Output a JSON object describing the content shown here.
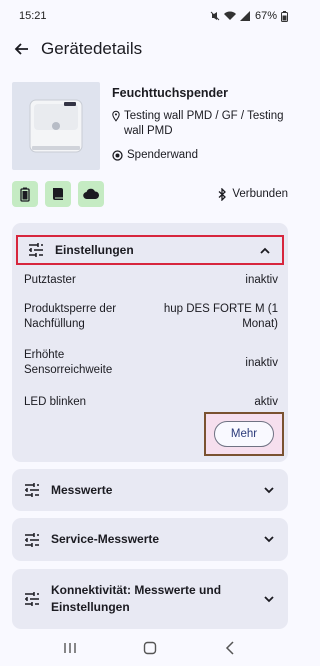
{
  "status_bar": {
    "time": "15:21",
    "battery": "67%"
  },
  "header": {
    "title": "Gerätedetails"
  },
  "product": {
    "name": "Feuchttuchspender",
    "location": "Testing wall PMD / GF / Testing wall  PMD",
    "wall": "Spenderwand"
  },
  "connection": {
    "status": "Verbunden"
  },
  "settings": {
    "title": "Einstellungen",
    "rows": [
      {
        "label": "Putztaster",
        "value": "inaktiv"
      },
      {
        "label": "Produktsperre der Nachfüllung",
        "value": "hup DES FORTE M (1 Monat)"
      },
      {
        "label": "Erhöhte Sensorreichweite",
        "value": "inaktiv"
      },
      {
        "label": "LED blinken",
        "value": "aktiv"
      }
    ],
    "more_label": "Mehr"
  },
  "sections": [
    {
      "title": "Messwerte"
    },
    {
      "title": "Service-Messwerte"
    },
    {
      "title": "Konnektivität: Messwerte und Einstellungen"
    }
  ],
  "colors": {
    "highlight_red": "#d7263d",
    "chip_green": "#c5ebc3",
    "card_bg": "#e8e9f3"
  }
}
